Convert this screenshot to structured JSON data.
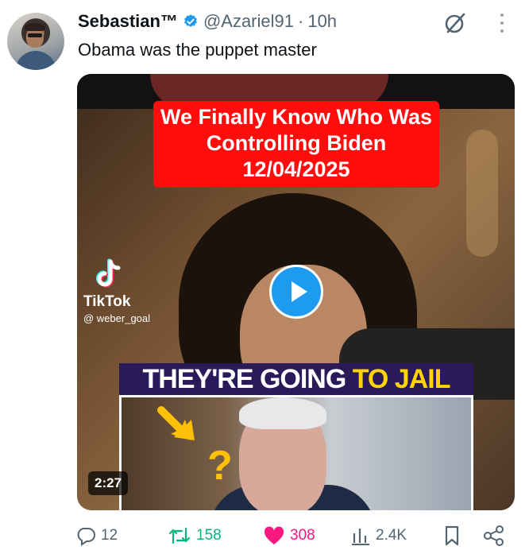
{
  "author": {
    "name": "Sebastian™",
    "handle": "@Azariel91",
    "separator": "·",
    "time": "10h"
  },
  "tweet": {
    "text": "Obama was the puppet master"
  },
  "media": {
    "headline_line1": "We Finally Know Who Was",
    "headline_line2": "Controlling Biden",
    "headline_line3": "12/04/2025",
    "watermark_brand": "TikTok",
    "watermark_user": "@ weber_goal",
    "banner_white": "THEY'RE GOING ",
    "banner_yellow": "TO JAIL",
    "overlay_qmark": "?",
    "duration": "2:27"
  },
  "actions": {
    "replies": "12",
    "retweets": "158",
    "likes": "308",
    "views": "2.4K"
  },
  "colors": {
    "accent": "#1d9bf0",
    "retweet": "#00ba7c",
    "like": "#f91880",
    "headline_bg": "#ff0d0d",
    "banner_yellow": "#ffd400"
  },
  "icons": [
    "verified-badge-icon",
    "grok-icon",
    "more-icon",
    "play-icon",
    "tiktok-logo-icon",
    "arrow-icon",
    "reply-icon",
    "retweet-icon",
    "like-icon",
    "views-icon",
    "bookmark-icon",
    "share-icon"
  ]
}
